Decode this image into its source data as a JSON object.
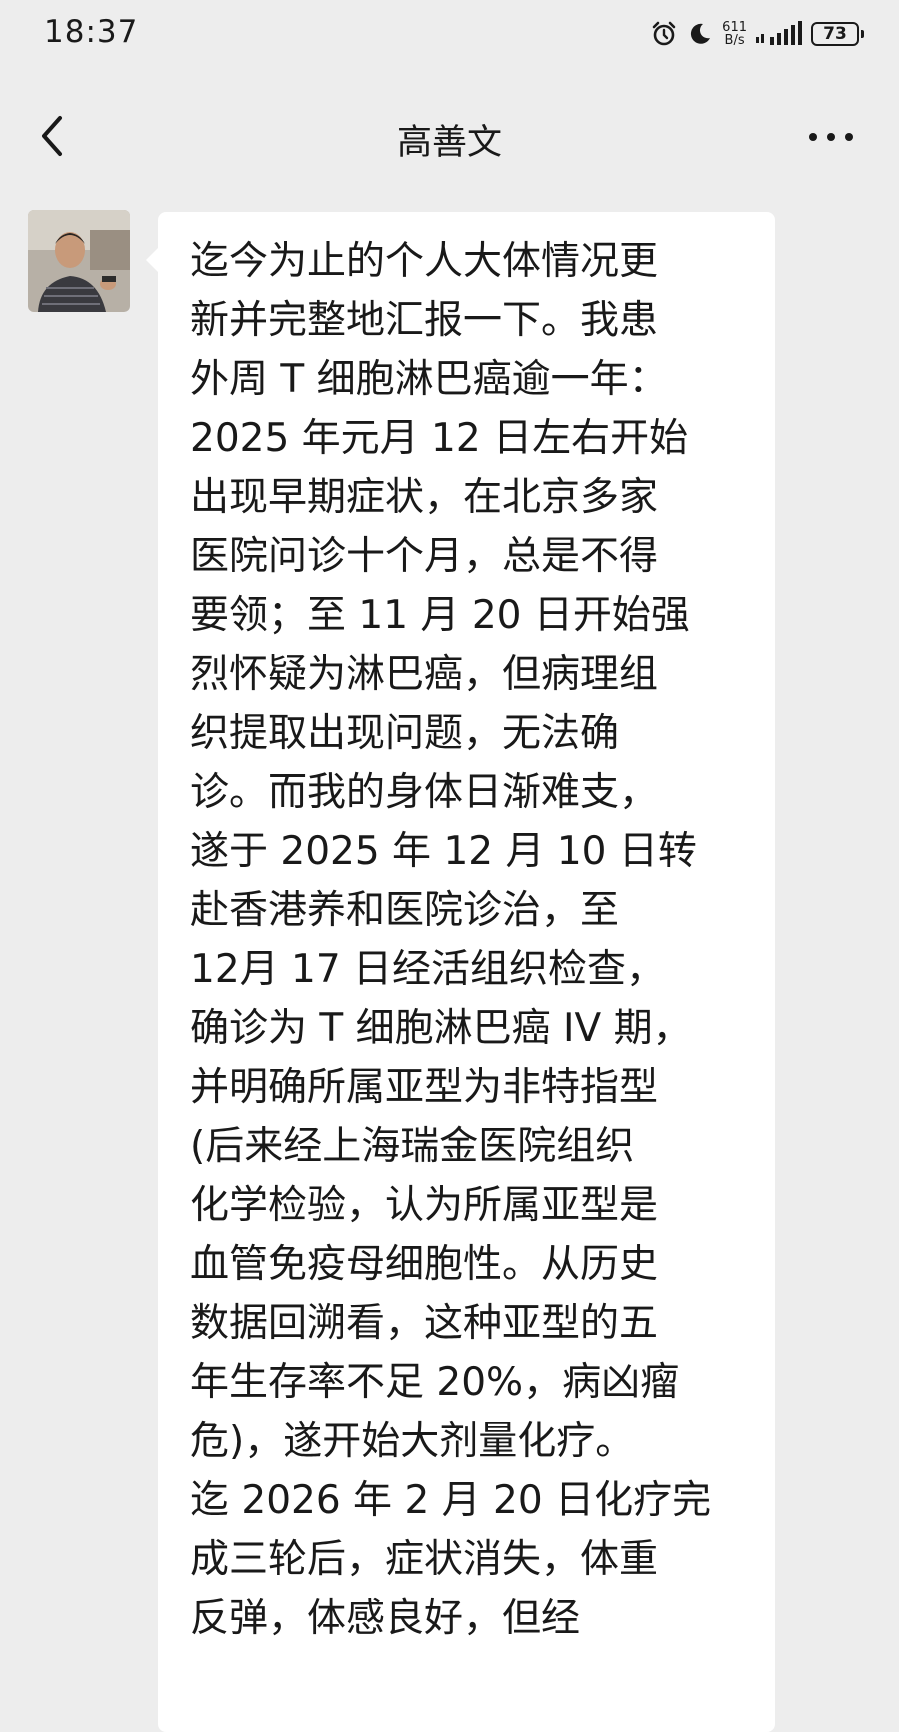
{
  "status_bar": {
    "time": "18:37",
    "net_speed_value": "611",
    "net_speed_unit": "B/s",
    "battery": "73",
    "icons": [
      "alarm-icon",
      "moon-icon",
      "signal-icon",
      "battery-icon"
    ]
  },
  "header": {
    "title": "高善文",
    "back_icon": "chevron-left-icon",
    "more_icon": "more-dots-icon"
  },
  "message": {
    "lines": [
      "迄今为止的个人大体情况更",
      "新并完整地汇报一下。我患",
      "外周 T 细胞淋巴癌逾一年：",
      "2025 年元月 12 日左右开始",
      "出现早期症状，在北京多家",
      "医院问诊十个月，总是不得",
      "要领；至 11 月 20 日开始强",
      "烈怀疑为淋巴癌，但病理组",
      "织提取出现问题，无法确",
      "诊。而我的身体日渐难支，",
      "遂于 2025 年 12 月 10 日转",
      "赴香港养和医院诊治，至",
      "12月 17 日经活组织检查，",
      "确诊为 T 细胞淋巴癌 IV 期，",
      "并明确所属亚型为非特指型",
      "(后来经上海瑞金医院组织",
      "化学检验，认为所属亚型是",
      "血管免疫母细胞性。从历史",
      "数据回溯看，这种亚型的五",
      "年生存率不足 20%，病凶瘤",
      "危)，遂开始大剂量化疗。",
      "迄 2026 年 2 月 20 日化疗完",
      "成三轮后，症状消失，体重",
      "反弹，体感良好，但经"
    ]
  },
  "colors": {
    "background": "#ededed",
    "bubble": "#ffffff",
    "text": "#191919"
  }
}
